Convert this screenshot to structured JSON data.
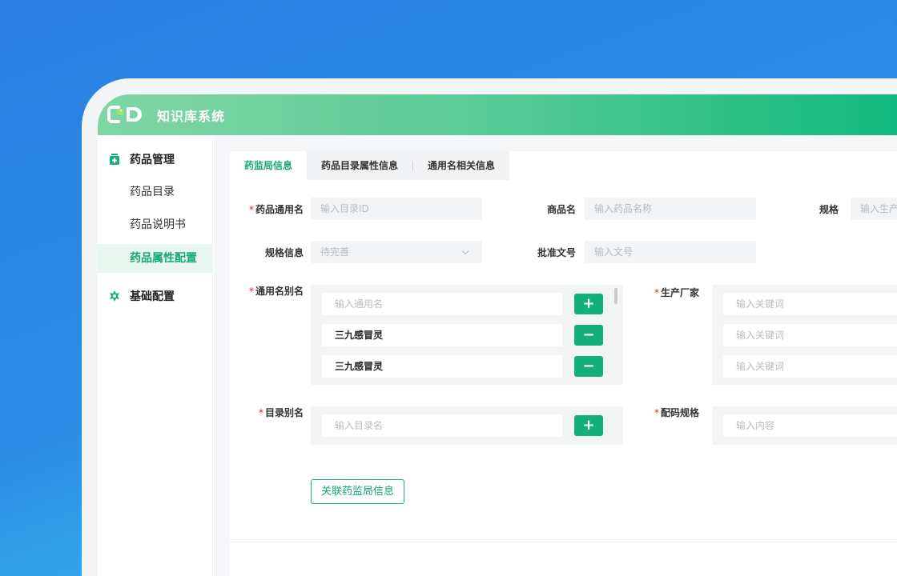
{
  "app": {
    "title": "知识库系统"
  },
  "colors": {
    "brand": "#13b07a",
    "accent_text": "#13a874",
    "required": "#e02020"
  },
  "sidebar": {
    "groups": [
      {
        "label": "药品管理",
        "icon": "medicine-bottle-icon"
      },
      {
        "label": "基础配置",
        "icon": "gear-icon"
      }
    ],
    "items": [
      {
        "label": "药品目录"
      },
      {
        "label": "药品说明书"
      },
      {
        "label": "药品属性配置",
        "active": true
      }
    ]
  },
  "tabs": [
    {
      "label": "药监局信息",
      "active": true
    },
    {
      "label": "药品目录属性信息"
    },
    {
      "label": "通用名相关信息"
    }
  ],
  "form": {
    "generic_name": {
      "label": "药品通用名",
      "placeholder": "输入目录ID"
    },
    "trade_name": {
      "label": "商品名",
      "placeholder": "输入药品名称"
    },
    "spec": {
      "label": "规格",
      "placeholder": "输入生产"
    },
    "spec_info": {
      "label": "规格信息",
      "placeholder": "待完善"
    },
    "approval_no": {
      "label": "批准文号",
      "placeholder": "输入文号"
    },
    "alias": {
      "label": "通用名别名",
      "placeholder": "输入通用名",
      "rows": [
        {
          "value": "三九感冒灵"
        },
        {
          "value": "三九感冒灵"
        }
      ]
    },
    "manufacturer": {
      "label": "生产厂家",
      "rows": [
        {
          "placeholder": "输入关键词"
        },
        {
          "placeholder": "输入关键词"
        },
        {
          "placeholder": "输入关键词"
        }
      ]
    },
    "catalog_alias": {
      "label": "目录别名",
      "placeholder": "输入目录名"
    },
    "code_spec": {
      "label": "配码规格",
      "placeholder": "输入内容"
    },
    "link_button": "关联药监局信息",
    "add_symbol": "+",
    "remove_symbol": "−"
  }
}
